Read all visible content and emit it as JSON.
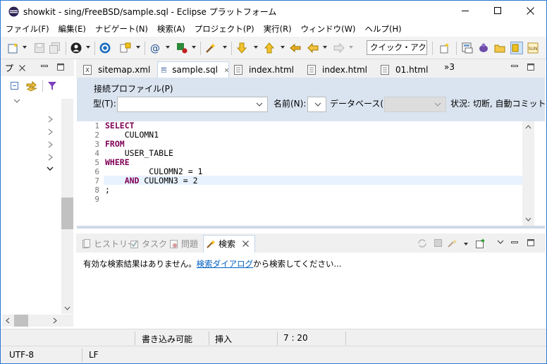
{
  "window": {
    "title": "showkit - sing/FreeBSD/sample.sql - Eclipse プラットフォーム"
  },
  "menu": [
    {
      "label": "ファイル(F)"
    },
    {
      "label": "編集(E)"
    },
    {
      "label": "ナビゲート(N)"
    },
    {
      "label": "検索(A)"
    },
    {
      "label": "プロジェクト(P)"
    },
    {
      "label": "実行(R)"
    },
    {
      "label": "ウィンドウ(W)"
    },
    {
      "label": "ヘルプ(H)"
    }
  ],
  "toolbar": {
    "quick_access": "クイック・アクセス"
  },
  "left_view": {
    "tab_label": "プ"
  },
  "editor": {
    "tabs": [
      {
        "label": "sitemap.xml",
        "icon": "xml-file-icon"
      },
      {
        "label": "sample.sql",
        "icon": "sql-file-icon",
        "active": true
      },
      {
        "label": "index.html",
        "icon": "html-file-icon"
      },
      {
        "label": "index.html",
        "icon": "html-file-icon"
      },
      {
        "label": "01.html",
        "icon": "html-file-icon"
      }
    ],
    "overflow_label": "»3",
    "connection": {
      "title": "接続プロファイル(P)",
      "type_label": "型(T):",
      "name_label": "名前(N):",
      "database_label": "データベース(B):",
      "status_text": "状況: 切断, 自動コミット"
    },
    "line_numbers": [
      "1",
      "2",
      "3",
      "4",
      "5",
      "6",
      "7",
      "8",
      "9"
    ],
    "code_lines": [
      {
        "kw": "SELECT",
        "text": ""
      },
      {
        "kw": "",
        "text": "    CULOMN1"
      },
      {
        "kw": "FROM",
        "text": ""
      },
      {
        "kw": "",
        "text": "    USER_TABLE"
      },
      {
        "kw": "WHERE",
        "text": ""
      },
      {
        "kw": "",
        "text": "         CULOMN2 = 1"
      },
      {
        "kw": "    AND",
        "text": " CULOMN3 = 2"
      },
      {
        "kw": "",
        "text": ";"
      },
      {
        "kw": "",
        "text": ""
      }
    ]
  },
  "bottom_view": {
    "tabs": [
      {
        "label": "ヒストリー"
      },
      {
        "label": "タスク"
      },
      {
        "label": "問題"
      },
      {
        "label": "検索"
      }
    ],
    "message_prefix": "有効な検索結果はありません。",
    "message_link": "検索ダイアログ",
    "message_suffix": "から検索してください..."
  },
  "status": {
    "writable": "書き込み可能",
    "insert_mode": "挿入",
    "position": "7 : 20",
    "encoding": "UTF-8",
    "line_delimiter": "LF"
  }
}
